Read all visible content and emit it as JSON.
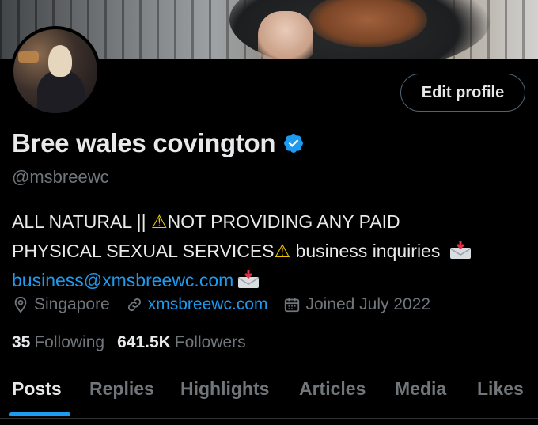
{
  "profile": {
    "name": "Bree wales covington",
    "handle": "@msbreewc",
    "verified_badge": "verified-badge",
    "edit_button_label": "Edit profile"
  },
  "bio": {
    "line1_text": "ALL NATURAL || ",
    "line1_warn": "⚠",
    "line1_rest": "NOT PROVIDING ANY PAID",
    "line2_text": "PHYSICAL SEXUAL SERVICES",
    "line2_warn": "⚠",
    "line2_rest": " business inquiries ",
    "email": "business@xmsbreewc.com"
  },
  "meta": {
    "location": "Singapore",
    "website": "xmsbreewc.com",
    "joined": "Joined July 2022"
  },
  "stats": {
    "following_count": "35",
    "following_label": "Following",
    "followers_count": "641.5K",
    "followers_label": "Followers"
  },
  "tabs": [
    {
      "label": "Posts",
      "active": true
    },
    {
      "label": "Replies",
      "active": false
    },
    {
      "label": "Highlights",
      "active": false
    },
    {
      "label": "Articles",
      "active": false
    },
    {
      "label": "Media",
      "active": false
    },
    {
      "label": "Likes",
      "active": false
    }
  ],
  "colors": {
    "accent": "#1d9bf0",
    "background": "#000000",
    "muted_text": "#71767b",
    "primary_text": "#e7e9ea"
  }
}
